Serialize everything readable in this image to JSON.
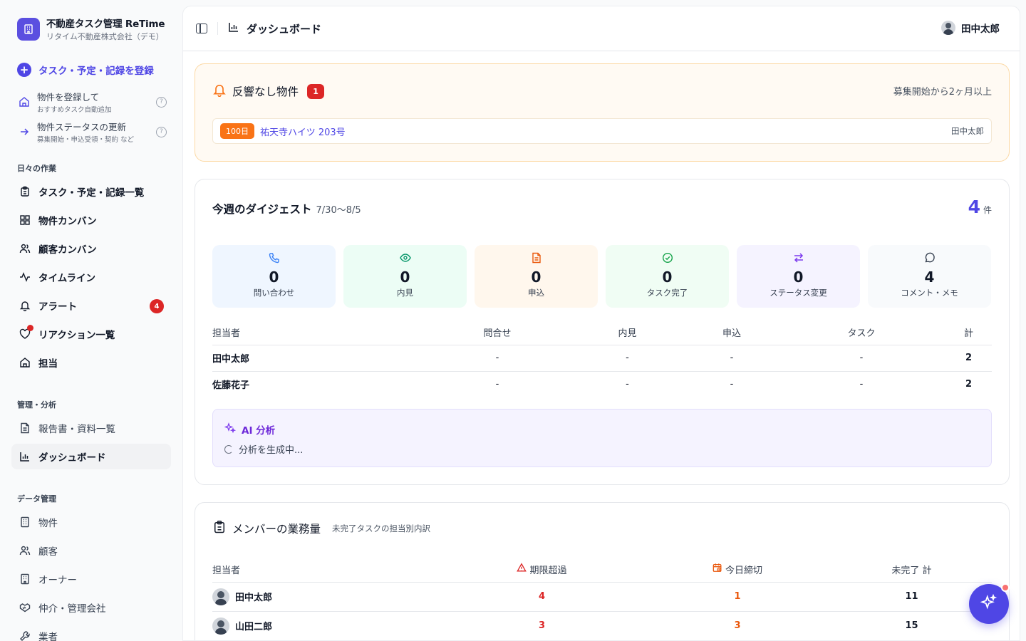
{
  "brand": {
    "title": "不動産タスク管理 ReTime",
    "subtitle": "リタイム不動産株式会社（デモ）"
  },
  "sidebar": {
    "primary_action": "タスク・予定・記録を登録",
    "sub_actions": [
      {
        "label": "物件を登録して",
        "sub": "おすすめタスク自動追加"
      },
      {
        "label": "物件ステータスの更新",
        "sub": "募集開始・申込受領・契約 など"
      }
    ],
    "sections": {
      "daily": "日々の作業",
      "manage": "管理・分析",
      "data": "データ管理"
    },
    "daily_items": [
      {
        "label": "タスク・予定・記録一覧",
        "icon": "clipboard-icon"
      },
      {
        "label": "物件カンバン",
        "icon": "grid-icon"
      },
      {
        "label": "顧客カンバン",
        "icon": "users-icon"
      },
      {
        "label": "タイムライン",
        "icon": "activity-icon"
      },
      {
        "label": "アラート",
        "icon": "bell-icon",
        "badge": "4"
      },
      {
        "label": "リアクション一覧",
        "icon": "heart-icon"
      },
      {
        "label": "担当",
        "icon": "home-icon"
      }
    ],
    "manage_items": [
      {
        "label": "報告書・資料一覧",
        "icon": "file-text-icon"
      },
      {
        "label": "ダッシュボード",
        "icon": "bar-chart-icon",
        "active": true
      }
    ],
    "data_items": [
      {
        "label": "物件",
        "icon": "building-icon"
      },
      {
        "label": "顧客",
        "icon": "users-icon"
      },
      {
        "label": "オーナー",
        "icon": "building-icon"
      },
      {
        "label": "仲介・管理会社",
        "icon": "handshake-icon"
      },
      {
        "label": "業者",
        "icon": "wrench-icon"
      }
    ]
  },
  "topbar": {
    "title": "ダッシュボード",
    "user": "田中太郎"
  },
  "alert": {
    "title": "反響なし物件",
    "count": "1",
    "note": "募集開始から2ヶ月以上",
    "rows": [
      {
        "days": "100日",
        "property": "祐天寺ハイツ 203号",
        "owner": "田中太郎"
      }
    ]
  },
  "digest": {
    "title": "今週のダイジェスト",
    "range": "7/30〜8/5",
    "total": "4",
    "total_unit": "件",
    "tiles": [
      {
        "value": "0",
        "label": "問い合わせ",
        "icon": "phone-icon",
        "color": "#3b82f6",
        "bg": "#eff6ff"
      },
      {
        "value": "0",
        "label": "内見",
        "icon": "eye-icon",
        "color": "#059669",
        "bg": "#ecfdf5"
      },
      {
        "value": "0",
        "label": "申込",
        "icon": "document-icon",
        "color": "#ea580c",
        "bg": "#fff7ed"
      },
      {
        "value": "0",
        "label": "タスク完了",
        "icon": "check-circle-icon",
        "color": "#16a34a",
        "bg": "#f0fdf4"
      },
      {
        "value": "0",
        "label": "ステータス変更",
        "icon": "swap-icon",
        "color": "#7c3aed",
        "bg": "#f5f3ff"
      },
      {
        "value": "4",
        "label": "コメント・メモ",
        "icon": "message-icon",
        "color": "#374151",
        "bg": "#f8fafc"
      }
    ],
    "columns": [
      "担当者",
      "問合せ",
      "内見",
      "申込",
      "タスク",
      "計"
    ],
    "rows": [
      [
        "田中太郎",
        "-",
        "-",
        "-",
        "-",
        "2"
      ],
      [
        "佐藤花子",
        "-",
        "-",
        "-",
        "-",
        "2"
      ]
    ],
    "ai": {
      "title": "AI 分析",
      "status": "分析を生成中..."
    }
  },
  "workload": {
    "title": "メンバーの業務量",
    "subtitle": "未完了タスクの担当別内訳",
    "columns": [
      "担当者",
      "期限超過",
      "今日締切",
      "未完了 計"
    ],
    "rows": [
      [
        "田中太郎",
        "4",
        "1",
        "11"
      ],
      [
        "山田二郎",
        "3",
        "3",
        "15"
      ]
    ]
  }
}
